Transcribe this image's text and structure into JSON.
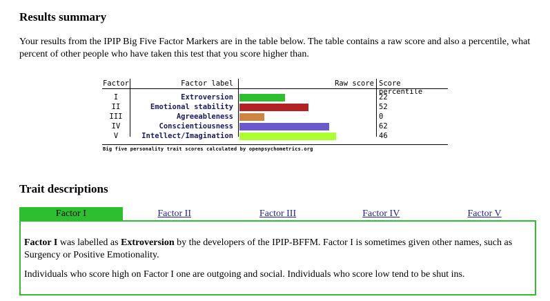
{
  "summary": {
    "heading": "Results summary",
    "intro": "Your results from the IPIP Big Five Factor Markers are in the table below. The table contains a raw score and also a percentile, what percent of other people who have taken this test that you score higher than."
  },
  "table": {
    "headers": {
      "factor": "Factor",
      "label": "Factor label",
      "raw": "Raw score",
      "pct": "Score percentile"
    },
    "rows": [
      {
        "factor": "I",
        "label": "Extroversion",
        "percentile": "22",
        "bar_fraction": 0.33,
        "color": "#2ebf2e"
      },
      {
        "factor": "II",
        "label": "Emotional stability",
        "percentile": "52",
        "bar_fraction": 0.5,
        "color": "#b22222"
      },
      {
        "factor": "III",
        "label": "Agreeableness",
        "percentile": "0",
        "bar_fraction": 0.18,
        "color": "#cd853f"
      },
      {
        "factor": "IV",
        "label": "Conscientiousness",
        "percentile": "62",
        "bar_fraction": 0.65,
        "color": "#6a5acd"
      },
      {
        "factor": "V",
        "label": "Intellect/Imagination",
        "percentile": "46",
        "bar_fraction": 0.7,
        "color": "#adff2f"
      }
    ],
    "footnote": "Big five personality trait scores calculated by openpsychometrics.org"
  },
  "traits": {
    "heading": "Trait descriptions",
    "tabs": [
      "Factor I",
      "Factor II",
      "Factor III",
      "Factor IV",
      "Factor V"
    ],
    "active_color": "#2ebf2e",
    "panel": {
      "p1_a": "Factor I",
      "p1_b": " was labelled as ",
      "p1_c": "Extroversion",
      "p1_d": " by the developers of the IPIP-BFFM. Factor I is sometimes given other names, such as Surgency or Positive Emotionality.",
      "p2": "Individuals who score high on Factor I one are outgoing and social. Individuals who score low tend to be shut ins."
    }
  }
}
